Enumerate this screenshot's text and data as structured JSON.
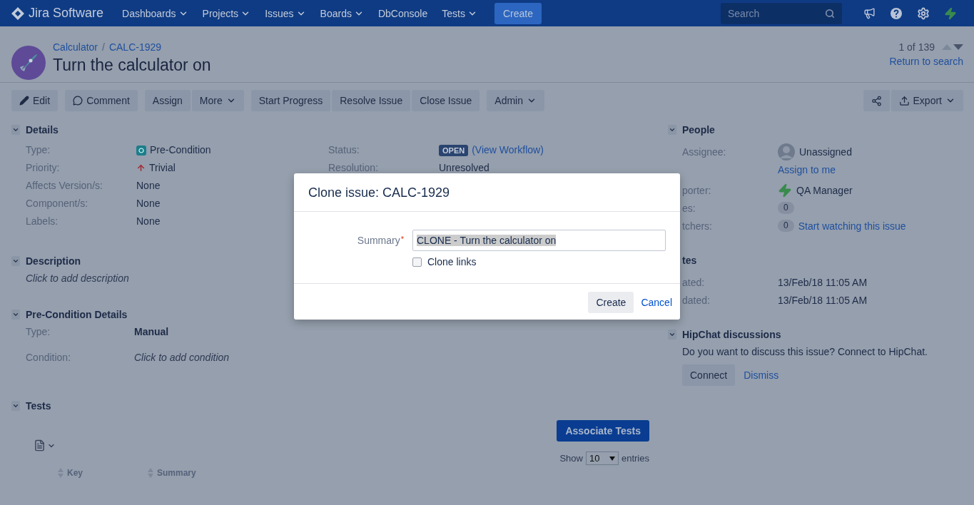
{
  "topbar": {
    "product": "Jira Software",
    "nav": [
      {
        "label": "Dashboards",
        "dropdown": true
      },
      {
        "label": "Projects",
        "dropdown": true
      },
      {
        "label": "Issues",
        "dropdown": true
      },
      {
        "label": "Boards",
        "dropdown": true
      },
      {
        "label": "DbConsole",
        "dropdown": false
      },
      {
        "label": "Tests",
        "dropdown": true
      }
    ],
    "create": "Create",
    "search": {
      "placeholder": "Search"
    }
  },
  "issue_header": {
    "breadcrumbs": [
      "Calculator",
      "CALC-1929"
    ],
    "separator": "/",
    "title": "Turn the calculator on",
    "pager": "1 of 139",
    "return_link": "Return to search"
  },
  "toolbar": {
    "edit": "Edit",
    "comment": "Comment",
    "assign": "Assign",
    "more": "More",
    "transitions": [
      "Start Progress",
      "Resolve Issue",
      "Close Issue"
    ],
    "admin": "Admin",
    "export": "Export"
  },
  "details": {
    "title": "Details",
    "left": [
      {
        "label": "Type:",
        "value": "Pre-Condition",
        "kind": "type"
      },
      {
        "label": "Priority:",
        "value": "Trivial",
        "kind": "priority"
      },
      {
        "label": "Affects Version/s:",
        "value": "None",
        "kind": "plain"
      },
      {
        "label": "Component/s:",
        "value": "None",
        "kind": "plain"
      },
      {
        "label": "Labels:",
        "value": "None",
        "kind": "plain"
      }
    ],
    "right": [
      {
        "label": "Status:",
        "badge": "OPEN",
        "value": "(View Workflow)",
        "kind": "status"
      },
      {
        "label": "Resolution:",
        "value": "Unresolved",
        "kind": "plain"
      }
    ]
  },
  "description": {
    "title": "Description",
    "placeholder": "Click to add description"
  },
  "precondition": {
    "title": "Pre-Condition Details",
    "type_label": "Type:",
    "type_value": "Manual",
    "condition_label": "Condition:",
    "condition_placeholder": "Click to add condition"
  },
  "tests": {
    "title": "Tests",
    "associate_button": "Associate Tests",
    "show": "Show",
    "page_size": "10",
    "entries": "entries",
    "columns": [
      "Key",
      "Summary"
    ]
  },
  "people": {
    "title": "People",
    "assignee_label": "Assignee:",
    "assignee": "Unassigned",
    "assign_link": "Assign to me",
    "reporter_label": "porter:",
    "reporter": "QA Manager",
    "votes_label": "es:",
    "votes": "0",
    "watchers_label": "tchers:",
    "watchers": "0",
    "watch_link": "Start watching this issue"
  },
  "dates": {
    "title": "tes",
    "rows": [
      {
        "label": "ated:",
        "value": "13/Feb/18 11:05 AM"
      },
      {
        "label": "dated:",
        "value": "13/Feb/18 11:05 AM"
      }
    ]
  },
  "hipchat": {
    "title": "HipChat discussions",
    "message": "Do you want to discuss this issue? Connect to HipChat.",
    "connect": "Connect",
    "dismiss": "Dismiss"
  },
  "dialog": {
    "title": "Clone issue: CALC-1929",
    "summary_label": "Summary",
    "required_mark": "*",
    "summary_value": "CLONE - Turn the calculator on",
    "clone_links": {
      "label": "Clone links",
      "checked": false
    },
    "create": "Create",
    "cancel": "Cancel"
  }
}
